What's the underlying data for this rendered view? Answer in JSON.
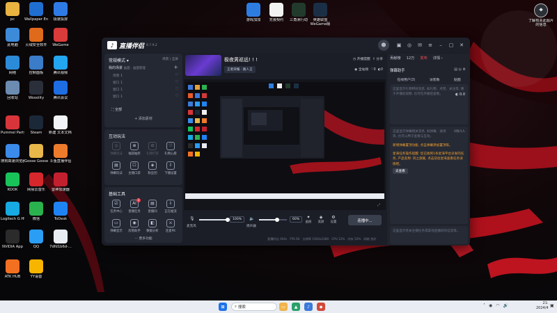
{
  "desktop": {
    "icons_left": [
      {
        "label": "pc",
        "icon": "folder-icon",
        "color": "#e8b341"
      },
      {
        "label": "Wallpaper Engine: ...",
        "icon": "wallpaper-engine-icon",
        "color": "#1f6fd1"
      },
      {
        "label": "极速投屏",
        "icon": "cast-icon",
        "color": "#2f7be6"
      },
      {
        "label": "此电脑",
        "icon": "computer-icon",
        "color": "#3d8ad9"
      },
      {
        "label": "火绒安全软件",
        "icon": "huorong-icon",
        "color": "#e06a1b"
      },
      {
        "label": "WeGame",
        "icon": "wegame-icon",
        "color": "#d93b3b"
      },
      {
        "label": "网络",
        "icon": "network-icon",
        "color": "#2c8bd8"
      },
      {
        "label": "控制面板",
        "icon": "control-panel-icon",
        "color": "#3a7cc8"
      },
      {
        "label": "腾讯视频",
        "icon": "tencent-video-icon",
        "color": "#23a5f0"
      },
      {
        "label": "回收站",
        "icon": "recycle-bin-icon",
        "color": "#6b8bb0"
      },
      {
        "label": "Wooolity",
        "icon": "app-icon",
        "color": "#2a2f3a"
      },
      {
        "label": "腾讯会议",
        "icon": "tencent-meeting-icon",
        "color": "#1e6de2"
      },
      {
        "label": "Pummel Party",
        "icon": "pummel-party-icon",
        "color": "#d8353a"
      },
      {
        "label": "Steam",
        "icon": "steam-icon",
        "color": "#1b2838"
      },
      {
        "label": "新建 文本文档 (2)",
        "icon": "text-file-icon",
        "color": "#f2f4f7"
      },
      {
        "label": "搜狗高速浏览器",
        "icon": "sogou-browser-icon",
        "color": "#3a8bea"
      },
      {
        "label": "Goose Goose Duck",
        "icon": "goose-duck-icon",
        "color": "#e7b74a"
      },
      {
        "label": "斗鱼直播伴侣",
        "icon": "douyu-icon",
        "color": "#ee7b2c"
      },
      {
        "label": "KOOK",
        "icon": "kook-icon",
        "color": "#18c35a"
      },
      {
        "label": "网易云音乐",
        "icon": "netease-music-icon",
        "color": "#d6272c"
      },
      {
        "label": "雷神加速器",
        "icon": "leishen-icon",
        "color": "#c3202f"
      },
      {
        "label": "Logitech G HUB",
        "icon": "ghub-icon",
        "color": "#17a9e1"
      },
      {
        "label": "微信",
        "icon": "wechat-icon",
        "color": "#2ab24e"
      },
      {
        "label": "ToDesk",
        "icon": "todesk-icon",
        "color": "#1f84f3"
      },
      {
        "label": "NVIDIA App",
        "icon": "nvidia-icon",
        "color": "#2b2b2b"
      },
      {
        "label": "QQ",
        "icon": "qq-icon",
        "color": "#2a9df4"
      },
      {
        "label": "7dfd1b6d-...",
        "icon": "document-icon",
        "color": "#e9edf3"
      },
      {
        "label": "ATK HUB",
        "icon": "atk-hub-icon",
        "color": "#f37021"
      },
      {
        "label": "YY语音",
        "icon": "yy-icon",
        "color": "#f7b500"
      }
    ],
    "icons_top": [
      {
        "label": "游戏加加",
        "icon": "youxijiajia-icon",
        "color": "#2d7de1"
      },
      {
        "label": "无畏契约",
        "icon": "valorant-icon",
        "color": "#f2f2f2"
      },
      {
        "label": "三角洲行动",
        "icon": "delta-force-icon",
        "color": "#223a2c"
      },
      {
        "label": "英雄联盟 WeGame版",
        "icon": "lol-icon",
        "color": "#1a2f45"
      }
    ],
    "icon_top_right": {
      "label": "了解有关此图片的信息",
      "icon": "info-icon",
      "color": "#2b2f36"
    }
  },
  "app": {
    "name": "直播伴侣",
    "version": "8.7.9.2",
    "banner_title": "极夜男巡远! ! !",
    "stream_tag_1": "王者荣耀 · 路人王",
    "title_actions": [
      "开播提醒",
      "分享"
    ],
    "stats": [
      "全站榜",
      "0",
      "0"
    ],
    "scene_header": {
      "title": "常规模式",
      "opt1": "场景",
      "opt2": "全屏"
    },
    "my_scene": {
      "label": "我的场景",
      "sub": "画面 · 画面管理"
    },
    "scenes": [
      "场景 1",
      "窗口 1",
      "窗口 1",
      "窗口 1"
    ],
    "all_label": "全部",
    "add_material": "+ 添加素材",
    "interactive": {
      "title": "互动玩法",
      "items": [
        {
          "label": "弹幕玩法",
          "dim": true
        },
        {
          "label": "福袋抽奖",
          "dim": false
        },
        {
          "label": "礼物打赏",
          "dim": true
        },
        {
          "label": "礼物心愿",
          "dim": false
        },
        {
          "label": "弹幕玩法",
          "dim": false
        },
        {
          "label": "主播口袋",
          "dim": false
        },
        {
          "label": "粉丝团",
          "dim": false
        },
        {
          "label": "下播设置",
          "dim": false
        }
      ]
    },
    "tools": {
      "title": "基础工具",
      "items": [
        {
          "label": "任务中心",
          "badge": ""
        },
        {
          "label": "直播任务",
          "badge": "1"
        },
        {
          "label": "直播间",
          "badge": ""
        },
        {
          "label": "正在推流",
          "badge": ""
        },
        {
          "label": "弹幕显示",
          "badge": ""
        },
        {
          "label": "房管助手",
          "badge": ""
        },
        {
          "label": "数据分析",
          "badge": ""
        },
        {
          "label": "连麦PK",
          "badge": ""
        }
      ],
      "more": "··· 更多功能"
    },
    "controls": {
      "mic_label": "麦克风",
      "mic_volume": "100%",
      "speaker_label": "扬声器",
      "speaker_volume": "60%",
      "buttons": [
        "画质",
        "美颜",
        "设置"
      ],
      "start_button": "连播中..."
    },
    "status_bar": [
      "直播时长 0h0s",
      "FPS 60",
      "分辨率 1920x1080",
      "CPU 12%",
      "内存 52%",
      "网络 良好"
    ],
    "right": {
      "tabs": [
        "贡献榜",
        "12万",
        "发布",
        "详情"
      ],
      "danmu_title": "弹幕助手",
      "subtabs": [
        "在线用户(3)",
        "访客数",
        "贴图"
      ],
      "hint1": "这里显示礼物特效消息, 如礼物、点赞、关注等, 便于开播前观察, 也可在开播后查看。",
      "score": "0.0",
      "hint2": "这里显示弹幕相关消息, 如弹幕、进场等, 也可以用于查看与互动。",
      "right_badge": "0场/1人",
      "warn_1": "新增弹幕置顶功能, 点击弹幕添加置顶等。",
      "warn_2": "星海任务操作提醒: 您已收到1条星海平台派发的任务, 产品名称: 风之旗舰, 点击前往星海查看任务详情吧。",
      "go_button": "去查看",
      "hint3": "这里显示有关主播任务或其他直播间的信息等。"
    }
  },
  "taskbar": {
    "search_placeholder": "搜索",
    "time": "21:",
    "date": "2024/4"
  }
}
